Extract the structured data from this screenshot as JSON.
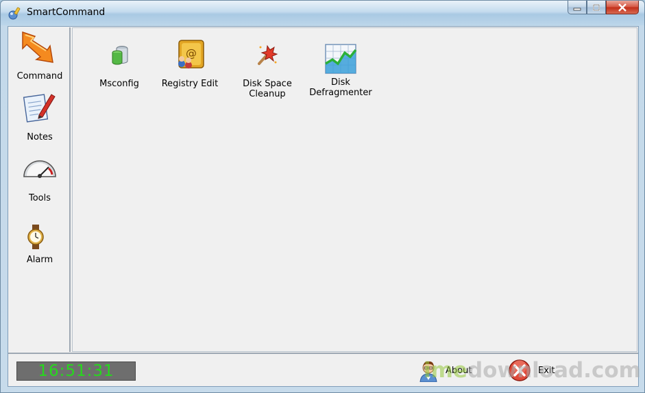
{
  "window": {
    "title": "SmartCommand"
  },
  "sidebar": {
    "items": [
      {
        "label": "Command",
        "icon": "command-arrow-icon"
      },
      {
        "label": "Notes",
        "icon": "notes-pen-icon"
      },
      {
        "label": "Tools",
        "icon": "gauge-icon"
      },
      {
        "label": "Alarm",
        "icon": "watch-icon"
      }
    ]
  },
  "tools": [
    {
      "label": "Msconfig",
      "icon": "msconfig-icon"
    },
    {
      "label": "Registry Edit",
      "icon": "registry-icon"
    },
    {
      "label": "Disk Space Cleanup",
      "line1": "Disk Space",
      "line2": "Cleanup",
      "icon": "cleanup-icon"
    },
    {
      "label": "Disk Defragmenter",
      "line1": "Disk",
      "line2": "Defragmenter",
      "icon": "defrag-icon"
    }
  ],
  "footer": {
    "clock": "16:51:31",
    "about_label": "About",
    "exit_label": "Exit"
  },
  "watermark": {
    "text1": "ime",
    "text2": "download.com"
  },
  "colors": {
    "clock_text": "#26d91c",
    "clock_bg": "#6e6e6e",
    "close_button": "#c12d18"
  }
}
